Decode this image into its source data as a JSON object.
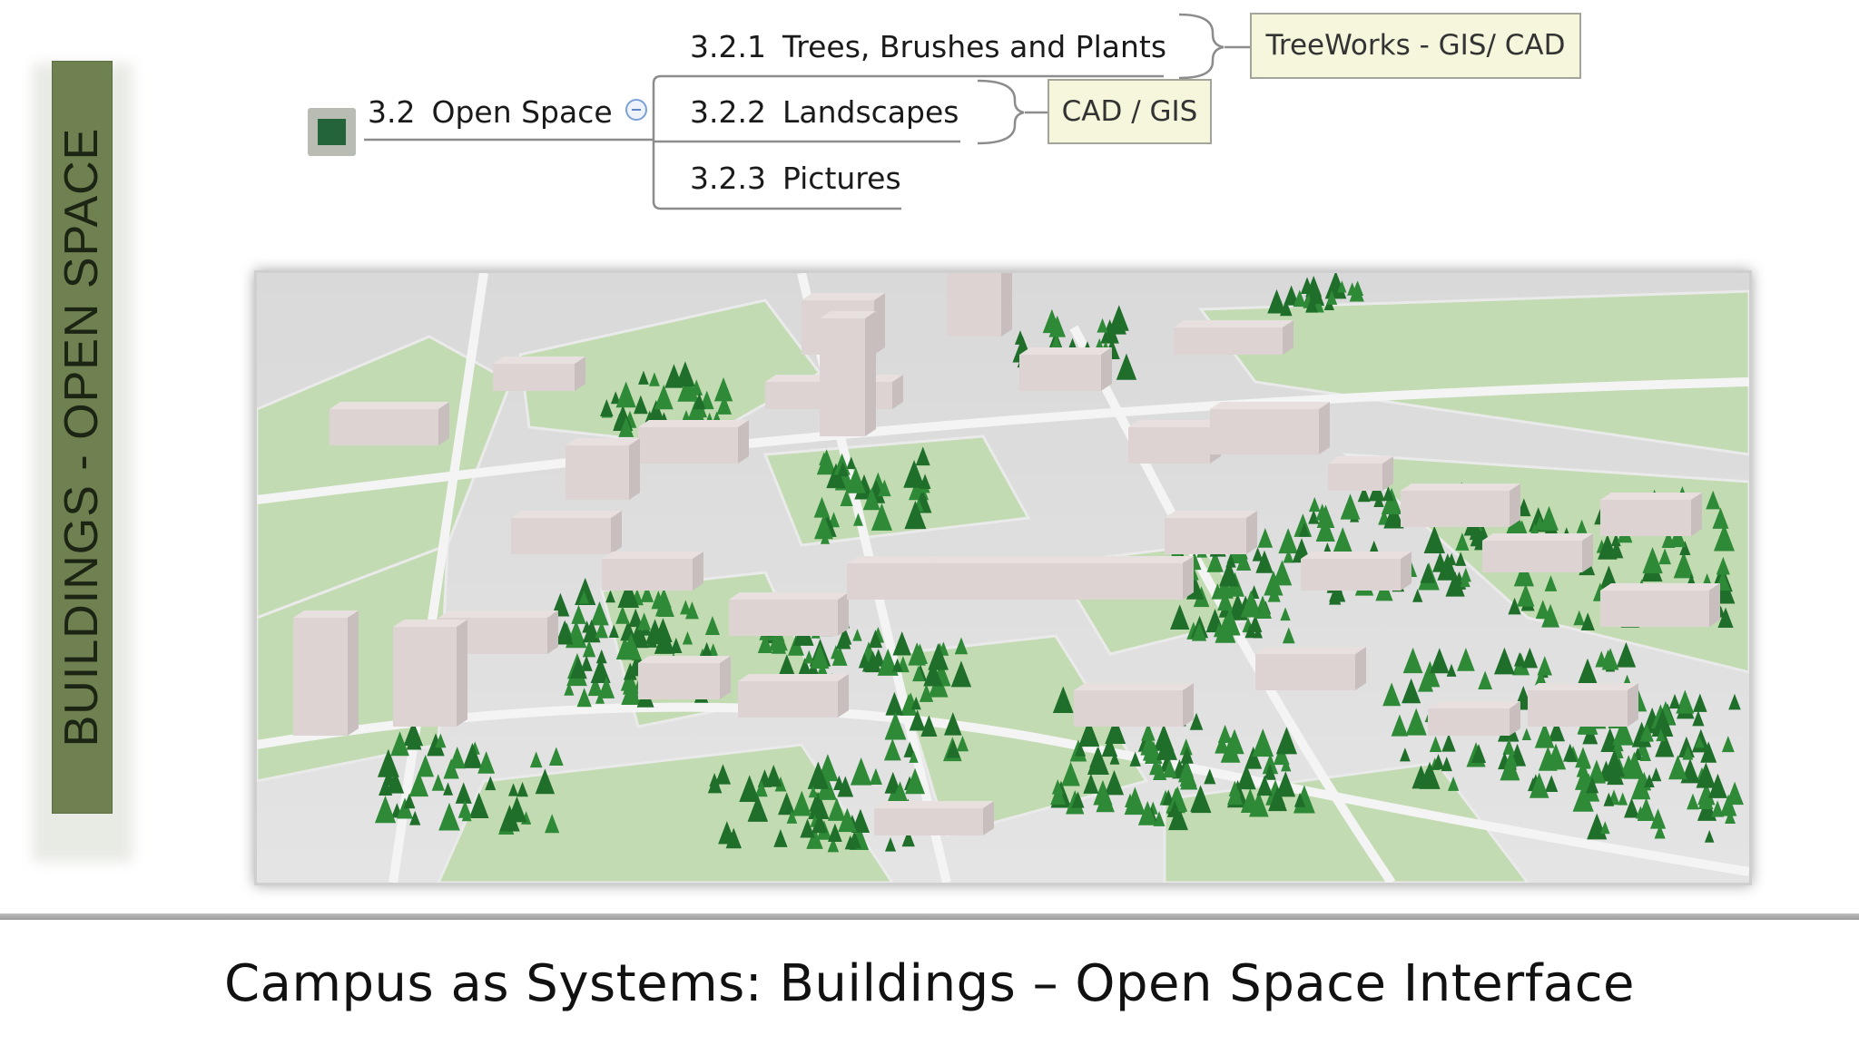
{
  "sidebar": {
    "banner_text": "BUILDINGS - OPEN SPACE",
    "banner_color": "#6f8150"
  },
  "mindmap": {
    "root": {
      "number": "3.2",
      "label": "Open Space",
      "icon": "green-square-icon"
    },
    "children": [
      {
        "number": "3.2.1",
        "label": "Trees, Brushes and Plants",
        "tag": "TreeWorks - GIS/ CAD"
      },
      {
        "number": "3.2.2",
        "label": "Landscapes",
        "tag": "CAD / GIS"
      },
      {
        "number": "3.2.3",
        "label": "Pictures"
      }
    ]
  },
  "render": {
    "type": "3d-campus-aerial-view",
    "colors": {
      "ground": "#dcdcdc",
      "green_space": "#bcd7ab",
      "buildings": "#e8dfdf",
      "trees": "#1f6e2a"
    }
  },
  "caption": "Campus as Systems: Buildings – Open Space Interface"
}
